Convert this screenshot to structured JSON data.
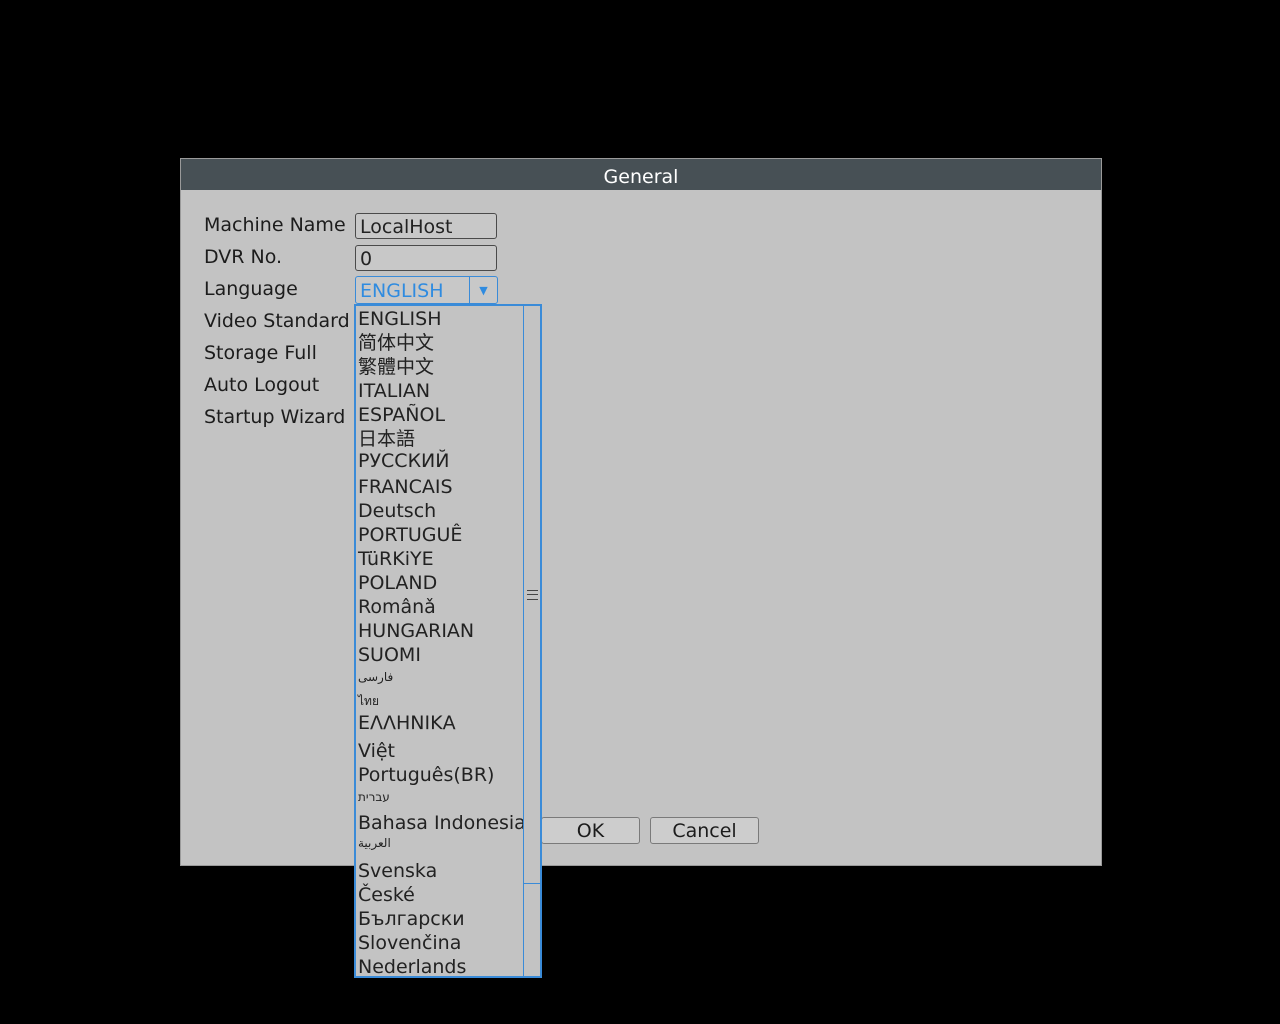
{
  "dialog": {
    "title": "General"
  },
  "labels": {
    "machine_name": "Machine Name",
    "dvr_no": "DVR No.",
    "language": "Language",
    "video_standard": "Video Standard",
    "storage_full": "Storage Full",
    "auto_logout": "Auto Logout",
    "startup_wizard": "Startup Wizard"
  },
  "fields": {
    "machine_name_value": "LocalHost",
    "dvr_no_value": "0",
    "language_value": "ENGLISH"
  },
  "language_options": [
    "ENGLISH",
    "简体中文",
    "繁體中文",
    "ITALIAN",
    "ESPAÑOL",
    "日本語",
    "РУССКИЙ",
    "FRANCAIS",
    "Deutsch",
    "PORTUGUÊ",
    "TüRKiYE",
    "POLAND",
    "Românǎ",
    "HUNGARIAN",
    "SUOMI",
    "فارسی",
    "ไทย",
    "ΕΛΛΗΝΙΚΑ",
    "Việt",
    "Português(BR)",
    "עברית",
    "Bahasa Indonesia",
    "العربية",
    "Svenska",
    "České",
    "Български",
    "Slovenčina",
    "Nederlands"
  ],
  "buttons": {
    "ok": "OK",
    "cancel": "Cancel"
  },
  "colors": {
    "accent": "#3a8bd8",
    "titlebar": "#475055",
    "panel": "#c3c3c3"
  },
  "icons": {
    "dropdown_arrow": "chevron-down-icon",
    "scroll_grip": "grip-icon"
  }
}
